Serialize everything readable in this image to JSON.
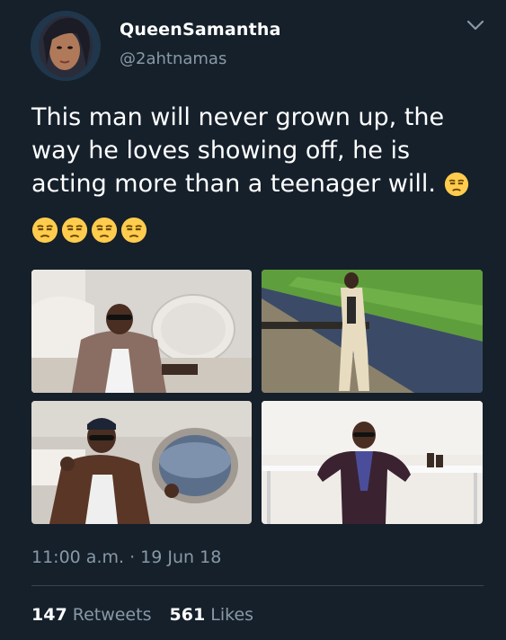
{
  "user": {
    "display_name": "QueenSamantha",
    "handle": "@2ahtnamas"
  },
  "tweet": {
    "text": "This man will never grown up, the way he loves showing off, he is acting more than a teenager will.",
    "emoji_icon": "unamused-face-icon",
    "trailing_emoji_count": 4
  },
  "media": [
    {
      "icon": "photo-man-in-private-jet-seat"
    },
    {
      "icon": "photo-man-at-stadium-box"
    },
    {
      "icon": "photo-man-thumbs-up-by-window"
    },
    {
      "icon": "photo-man-seated-at-table"
    }
  ],
  "meta": {
    "time": "11:00 a.m.",
    "separator": "·",
    "date": "19 Jun 18"
  },
  "stats": {
    "retweets_count": "147",
    "retweets_label": "Retweets",
    "likes_count": "561",
    "likes_label": "Likes"
  },
  "colors": {
    "background": "#15202b",
    "primary_text": "#ffffff",
    "secondary_text": "#8899a6",
    "divider": "#38444d"
  }
}
